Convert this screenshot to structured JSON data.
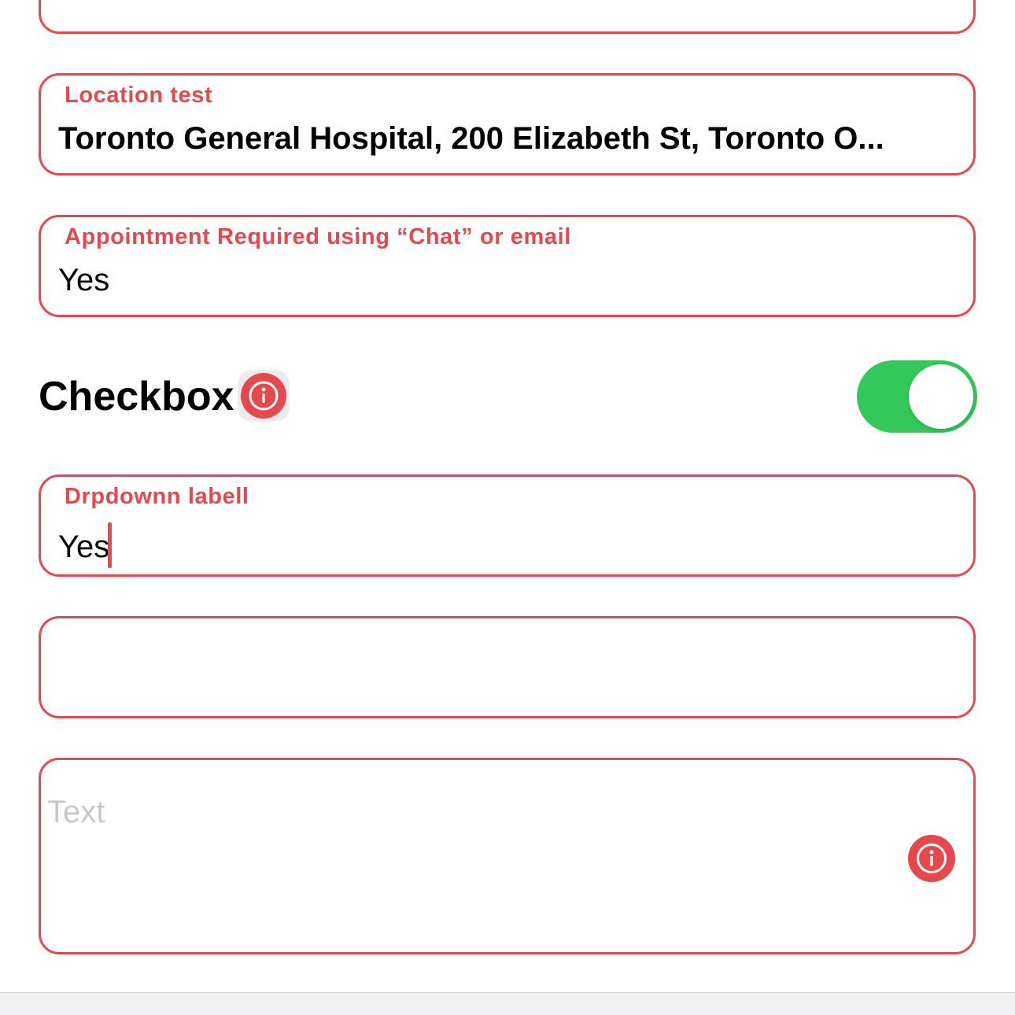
{
  "colors": {
    "accent": "#e5484d",
    "toggle_on": "#34c759",
    "placeholder": "#c8c8c8"
  },
  "fields": {
    "location": {
      "label": "Location test",
      "value": "Toronto General Hospital, 200 Elizabeth St, Toronto O..."
    },
    "appointment": {
      "label": "Appointment Required using “Chat” or email",
      "value": "Yes"
    },
    "dropdown": {
      "label": "Drpdownn labell",
      "value": "Yes"
    },
    "text_area": {
      "placeholder": "Text"
    }
  },
  "checkbox": {
    "label": "Checkbox",
    "info_icon": "info-icon",
    "toggle_on": true
  }
}
